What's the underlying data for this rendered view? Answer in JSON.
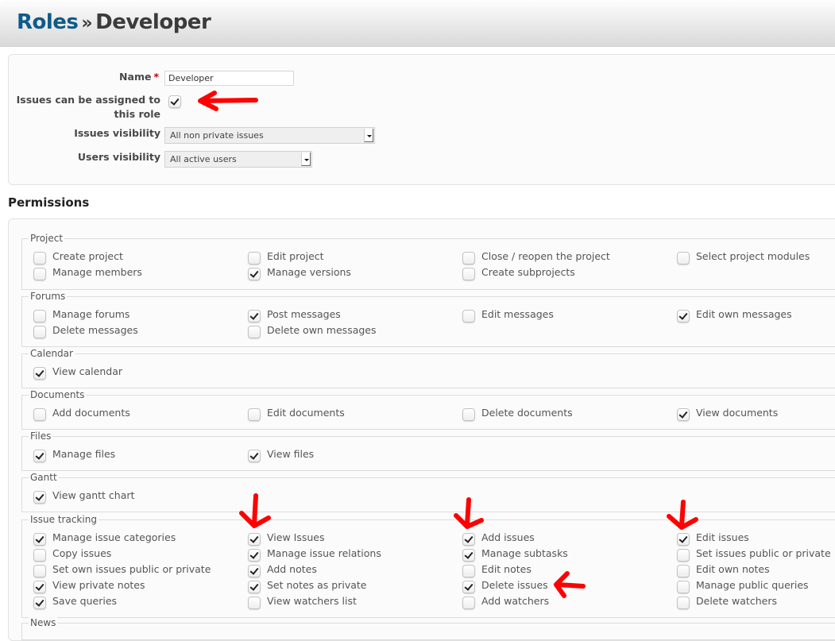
{
  "header": {
    "breadcrumb_link": "Roles",
    "separator": "»",
    "current": "Developer"
  },
  "form": {
    "name_label": "Name",
    "required_mark": "*",
    "name_value": "Developer",
    "assignable_label_line1": "Issues can be assigned to",
    "assignable_label_line2": "this role",
    "assignable_checked": true,
    "issues_visibility_label": "Issues visibility",
    "issues_visibility_value": "All non private issues",
    "users_visibility_label": "Users visibility",
    "users_visibility_value": "All active users"
  },
  "permissions": {
    "title": "Permissions",
    "groups": [
      {
        "name": "Project",
        "items": [
          {
            "label": "Create project",
            "checked": false
          },
          {
            "label": "Edit project",
            "checked": false
          },
          {
            "label": "Close / reopen the project",
            "checked": false
          },
          {
            "label": "Select project modules",
            "checked": false
          },
          {
            "label": "Manage members",
            "checked": false
          },
          {
            "label": "Manage versions",
            "checked": true
          },
          {
            "label": "Create subprojects",
            "checked": false
          }
        ]
      },
      {
        "name": "Forums",
        "items": [
          {
            "label": "Manage forums",
            "checked": false
          },
          {
            "label": "Post messages",
            "checked": true
          },
          {
            "label": "Edit messages",
            "checked": false
          },
          {
            "label": "Edit own messages",
            "checked": true
          },
          {
            "label": "Delete messages",
            "checked": false
          },
          {
            "label": "Delete own messages",
            "checked": false
          }
        ]
      },
      {
        "name": "Calendar",
        "items": [
          {
            "label": "View calendar",
            "checked": true
          }
        ]
      },
      {
        "name": "Documents",
        "items": [
          {
            "label": "Add documents",
            "checked": false
          },
          {
            "label": "Edit documents",
            "checked": false
          },
          {
            "label": "Delete documents",
            "checked": false
          },
          {
            "label": "View documents",
            "checked": true
          }
        ]
      },
      {
        "name": "Files",
        "items": [
          {
            "label": "Manage files",
            "checked": true
          },
          {
            "label": "View files",
            "checked": true
          }
        ]
      },
      {
        "name": "Gantt",
        "items": [
          {
            "label": "View gantt chart",
            "checked": true
          }
        ]
      },
      {
        "name": "Issue tracking",
        "items": [
          {
            "label": "Manage issue categories",
            "checked": true
          },
          {
            "label": "View Issues",
            "checked": true
          },
          {
            "label": "Add issues",
            "checked": true
          },
          {
            "label": "Edit issues",
            "checked": true
          },
          {
            "label": "Copy issues",
            "checked": false
          },
          {
            "label": "Manage issue relations",
            "checked": true
          },
          {
            "label": "Manage subtasks",
            "checked": true
          },
          {
            "label": "Set issues public or private",
            "checked": false
          },
          {
            "label": "Set own issues public or private",
            "checked": false
          },
          {
            "label": "Add notes",
            "checked": true
          },
          {
            "label": "Edit notes",
            "checked": false
          },
          {
            "label": "Edit own notes",
            "checked": false
          },
          {
            "label": "View private notes",
            "checked": true
          },
          {
            "label": "Set notes as private",
            "checked": true
          },
          {
            "label": "Delete issues",
            "checked": true
          },
          {
            "label": "Manage public queries",
            "checked": false
          },
          {
            "label": "Save queries",
            "checked": true
          },
          {
            "label": "View watchers list",
            "checked": false
          },
          {
            "label": "Add watchers",
            "checked": false
          },
          {
            "label": "Delete watchers",
            "checked": false
          }
        ]
      },
      {
        "name": "News",
        "items": []
      }
    ]
  },
  "annotations": {
    "arrow_color": "#ff0000"
  }
}
